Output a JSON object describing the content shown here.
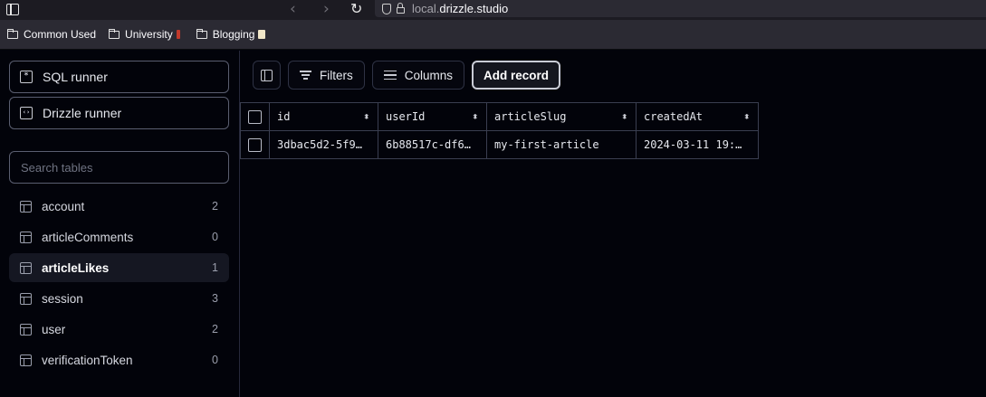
{
  "browser": {
    "url_prefix": "local.",
    "url_domain": "drizzle.studio",
    "back_glyph": "‹",
    "forward_glyph": "›",
    "reload_glyph": "↻",
    "bookmarks": [
      {
        "label": "Common Used"
      },
      {
        "label": "University"
      },
      {
        "label": "Blogging"
      }
    ]
  },
  "sidebar": {
    "sql_runner_label": "SQL runner",
    "sql_runner_glyph": "*",
    "drizzle_runner_label": "Drizzle runner",
    "drizzle_runner_glyph": "‹›",
    "search_placeholder": "Search tables",
    "tables": [
      {
        "name": "account",
        "count": "2"
      },
      {
        "name": "articleComments",
        "count": "0"
      },
      {
        "name": "articleLikes",
        "count": "1"
      },
      {
        "name": "session",
        "count": "3"
      },
      {
        "name": "user",
        "count": "2"
      },
      {
        "name": "verificationToken",
        "count": "0"
      }
    ],
    "active_table": "articleLikes"
  },
  "toolbar": {
    "filters_label": "Filters",
    "columns_label": "Columns",
    "add_record_label": "Add record"
  },
  "grid": {
    "sort_glyph": "⬍",
    "columns": [
      "id",
      "userId",
      "articleSlug",
      "createdAt"
    ],
    "rows": [
      [
        "3dbac5d2-5f9…",
        "6b88517c-df6…",
        "my-first-article",
        "2024-03-11 19:…"
      ]
    ]
  },
  "colors": {
    "background": "#02030a",
    "border": "#3a3e50",
    "active_row": "#151722"
  }
}
